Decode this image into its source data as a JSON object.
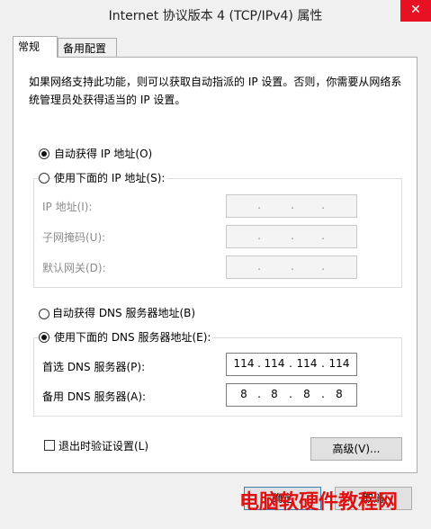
{
  "window": {
    "title": "Internet 协议版本 4 (TCP/IPv4) 属性",
    "close_glyph": "✕"
  },
  "tabs": [
    "常规",
    "备用配置"
  ],
  "description": "如果网络支持此功能，则可以获取自动指派的 IP 设置。否则，你需要从网络系统管理员处获得适当的 IP 设置。",
  "ip": {
    "auto_label": "自动获得 IP 地址(O)",
    "manual_label": "使用下面的 IP 地址(S):",
    "auto_selected": true,
    "fields": [
      {
        "label": "IP 地址(I):",
        "value": [
          "",
          "",
          "",
          ""
        ]
      },
      {
        "label": "子网掩码(U):",
        "value": [
          "",
          "",
          "",
          ""
        ]
      },
      {
        "label": "默认网关(D):",
        "value": [
          "",
          "",
          "",
          ""
        ]
      }
    ]
  },
  "dns": {
    "auto_label": "自动获得 DNS 服务器地址(B)",
    "manual_label": "使用下面的 DNS 服务器地址(E):",
    "manual_selected": true,
    "fields": [
      {
        "label": "首选 DNS 服务器(P):",
        "value": [
          "114",
          "114",
          "114",
          "114"
        ]
      },
      {
        "label": "备用 DNS 服务器(A):",
        "value": [
          "8",
          "8",
          "8",
          "8"
        ]
      }
    ]
  },
  "validate_on_exit": {
    "label": "退出时验证设置(L)",
    "checked": false
  },
  "advanced_button": "高级(V)...",
  "ok_button": "确定",
  "cancel_button": "取消",
  "watermark": "电脑软硬件教程网",
  "colors": {
    "close": "#e81123",
    "watermark": "#e01010"
  }
}
